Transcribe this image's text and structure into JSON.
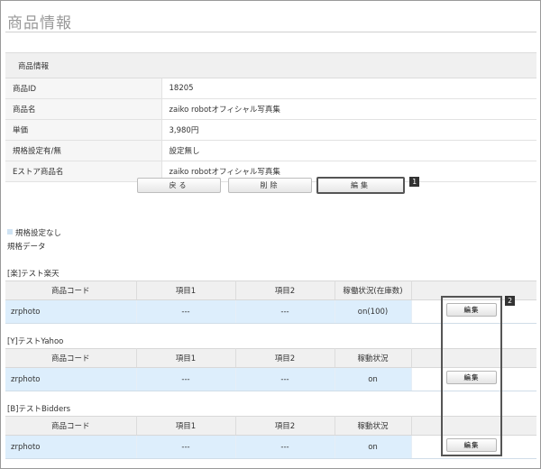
{
  "page": {
    "title": "商品情報"
  },
  "info": {
    "header": "商品情報",
    "rows": [
      {
        "label": "商品ID",
        "value": "18205"
      },
      {
        "label": "商品名",
        "value": "zaiko robotオフィシャル写真集"
      },
      {
        "label": "単価",
        "value": "3,980円"
      },
      {
        "label": "規格設定有/無",
        "value": "設定無し"
      },
      {
        "label": "Eストア商品名",
        "value": "zaiko robotオフィシャル写真集"
      }
    ]
  },
  "buttons": {
    "back": "戻る",
    "delete": "削除",
    "edit": "編集"
  },
  "markers": {
    "one": "1",
    "two": "2"
  },
  "spec": {
    "note": "規格設定なし",
    "data_label": "規格データ"
  },
  "stores": [
    {
      "name": "[楽]テスト楽天",
      "headers": [
        "商品コード",
        "項目1",
        "項目2",
        "稼働状況(在庫数)",
        ""
      ],
      "row": {
        "code": "zrphoto",
        "item1": "---",
        "item2": "---",
        "status": "on(100)",
        "edit": "編集"
      }
    },
    {
      "name": "[Y]テストYahoo",
      "headers": [
        "商品コード",
        "項目1",
        "項目2",
        "稼動状況",
        ""
      ],
      "row": {
        "code": "zrphoto",
        "item1": "---",
        "item2": "---",
        "status": "on",
        "edit": "編集"
      }
    },
    {
      "name": "[B]テストBidders",
      "headers": [
        "商品コード",
        "項目1",
        "項目2",
        "稼動状況",
        ""
      ],
      "row": {
        "code": "zrphoto",
        "item1": "---",
        "item2": "---",
        "status": "on",
        "edit": "編集"
      }
    }
  ]
}
